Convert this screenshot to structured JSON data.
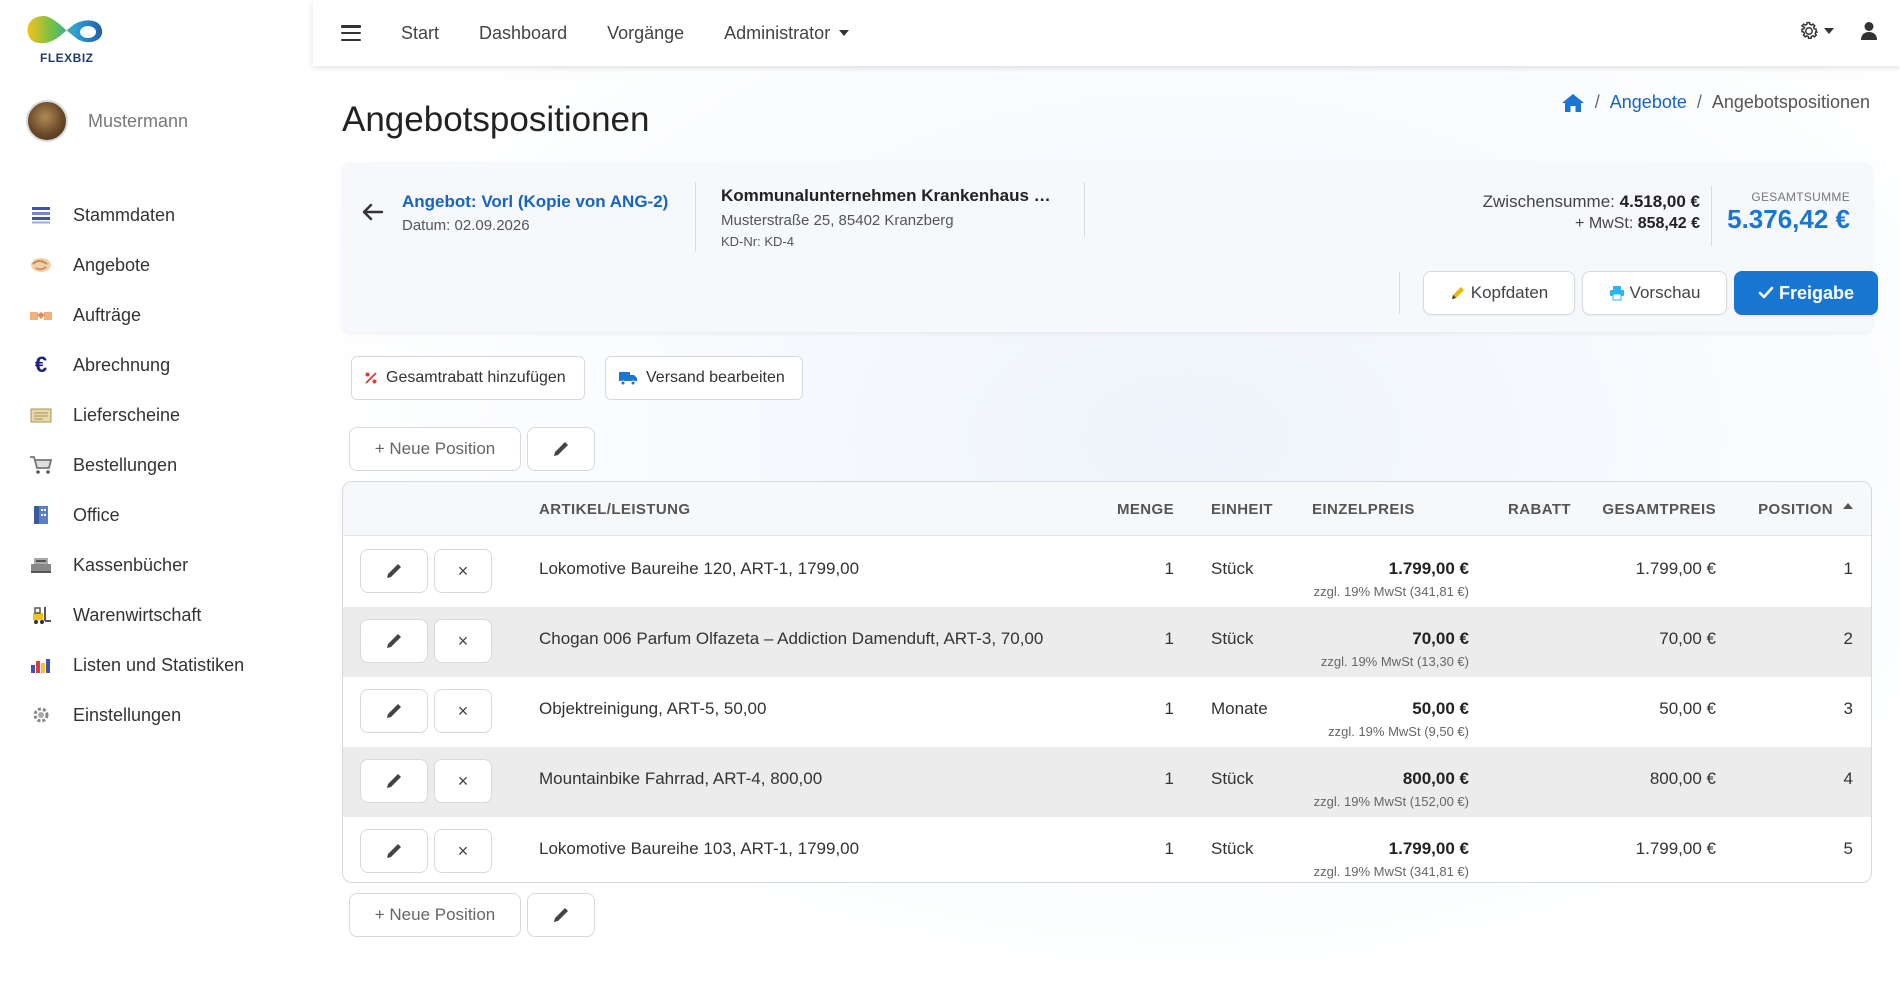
{
  "app": {
    "logo_text": "FLEXBIZ",
    "accent_color": "#1976d2"
  },
  "user": {
    "name": "Mustermann"
  },
  "sidebar": {
    "items": [
      {
        "label": "Stammdaten",
        "icon": "stack-icon"
      },
      {
        "label": "Angebote",
        "icon": "handshake-icon"
      },
      {
        "label": "Aufträge",
        "icon": "deal-icon"
      },
      {
        "label": "Abrechnung",
        "icon": "euro-icon"
      },
      {
        "label": "Lieferscheine",
        "icon": "delivery-note-icon"
      },
      {
        "label": "Bestellungen",
        "icon": "cart-icon"
      },
      {
        "label": "Office",
        "icon": "building-icon"
      },
      {
        "label": "Kassenbücher",
        "icon": "cash-register-icon"
      },
      {
        "label": "Warenwirtschaft",
        "icon": "forklift-icon"
      },
      {
        "label": "Listen und Statistiken",
        "icon": "bar-chart-icon"
      },
      {
        "label": "Einstellungen",
        "icon": "gear-icon"
      }
    ]
  },
  "topnav": {
    "items": [
      {
        "label": "Start"
      },
      {
        "label": "Dashboard"
      },
      {
        "label": "Vorgänge"
      },
      {
        "label": "Administrator",
        "dropdown": true
      }
    ]
  },
  "page": {
    "title": "Angebotspositionen"
  },
  "breadcrumb": {
    "link": "Angebote",
    "current": "Angebotspositionen"
  },
  "header": {
    "angebot_title": "Angebot: Vorl (Kopie von ANG-2)",
    "datum": "Datum: 02.09.2026",
    "customer_name": "Kommunalunternehmen Krankenhaus …",
    "customer_address": "Musterstraße 25, 85402 Kranzberg",
    "customer_nr": "KD-Nr: KD-4",
    "subtotal_label": "Zwischensumme:",
    "subtotal_value": "4.518,00 €",
    "mwst_label": "+ MwSt:",
    "mwst_value": "858,42 €",
    "gesamtsumme_label": "GESAMTSUMME",
    "gesamtsumme_value": "5.376,42 €",
    "btn_kopfdaten": "Kopfdaten",
    "btn_vorschau": "Vorschau",
    "btn_freigabe": "Freigabe"
  },
  "actions": {
    "rabatt": "Gesamtrabatt hinzufügen",
    "versand": "Versand bearbeiten",
    "neue_position": "+ Neue Position"
  },
  "table": {
    "headers": {
      "artikel": "ARTIKEL/LEISTUNG",
      "menge": "MENGE",
      "einheit": "EINHEIT",
      "einzelpreis": "EINZELPREIS",
      "rabatt": "RABATT",
      "gesamtpreis": "GESAMTPREIS",
      "position": "POSITION"
    },
    "rows": [
      {
        "artikel": "Lokomotive Baureihe 120, ART-1, 1799,00",
        "menge": "1",
        "einheit": "Stück",
        "einzelpreis": "1.799,00 €",
        "mwst": "zzgl. 19% MwSt (341,81 €)",
        "rabatt": "",
        "gesamtpreis": "1.799,00 €",
        "position": "1"
      },
      {
        "artikel": "Chogan 006 Parfum Olfazeta – Addiction Damenduft, ART-3, 70,00",
        "menge": "1",
        "einheit": "Stück",
        "einzelpreis": "70,00 €",
        "mwst": "zzgl. 19% MwSt (13,30 €)",
        "rabatt": "",
        "gesamtpreis": "70,00 €",
        "position": "2"
      },
      {
        "artikel": "Objektreinigung, ART-5, 50,00",
        "menge": "1",
        "einheit": "Monate",
        "einzelpreis": "50,00 €",
        "mwst": "zzgl. 19% MwSt (9,50 €)",
        "rabatt": "",
        "gesamtpreis": "50,00 €",
        "position": "3"
      },
      {
        "artikel": "Mountainbike Fahrrad, ART-4, 800,00",
        "menge": "1",
        "einheit": "Stück",
        "einzelpreis": "800,00 €",
        "mwst": "zzgl. 19% MwSt (152,00 €)",
        "rabatt": "",
        "gesamtpreis": "800,00 €",
        "position": "4"
      },
      {
        "artikel": "Lokomotive Baureihe 103, ART-1, 1799,00",
        "menge": "1",
        "einheit": "Stück",
        "einzelpreis": "1.799,00 €",
        "mwst": "zzgl. 19% MwSt (341,81 €)",
        "rabatt": "",
        "gesamtpreis": "1.799,00 €",
        "position": "5"
      }
    ]
  }
}
